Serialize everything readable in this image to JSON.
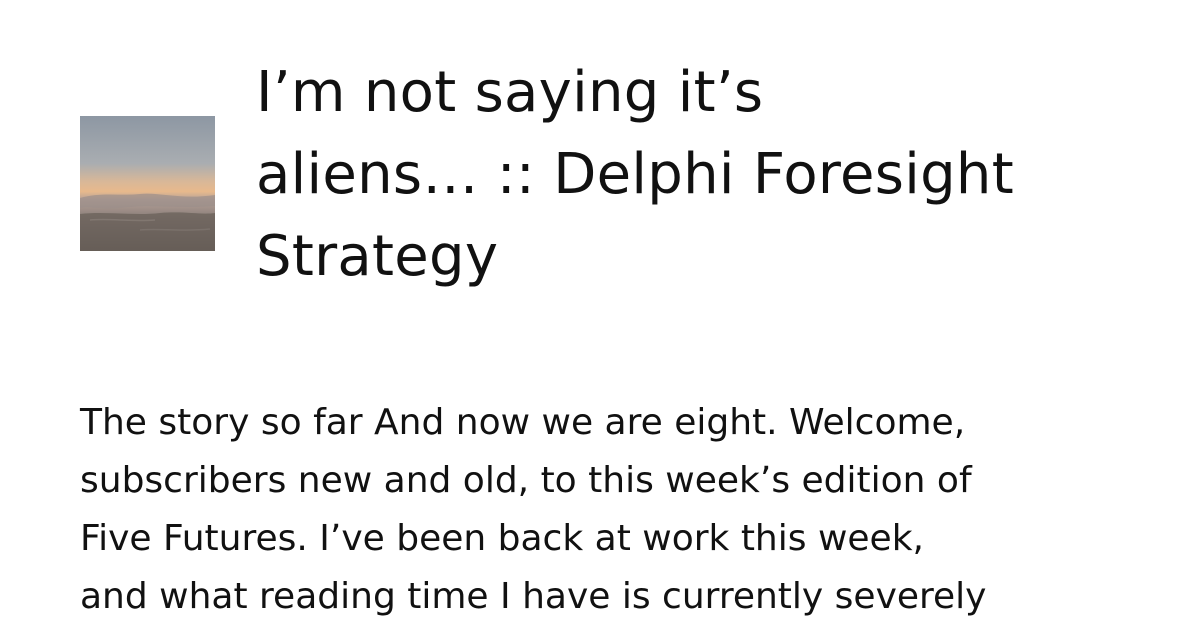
{
  "card": {
    "title_lines": [
      "I’m not saying it’s",
      "aliens… :: Delphi Foresight",
      "Strategy"
    ],
    "excerpt_lines": [
      "The story so far And now we are eight. Welcome,",
      "subscribers new and old, to this week’s edition of",
      "Five Futures. I’ve been back at work this week,",
      "and what reading time I have is currently severely"
    ],
    "thumbnail": {
      "icon": "sunset-landscape-image",
      "colors": {
        "sky_top": "#8d97a3",
        "horizon": "#e8b98c",
        "ground": "#5e5651"
      }
    }
  }
}
